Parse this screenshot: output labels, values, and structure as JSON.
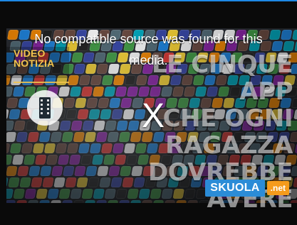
{
  "video_player": {
    "poster": {
      "banner": {
        "line1": "VIDEO",
        "line2": "NOTIZIA"
      },
      "headline": {
        "line1": "LE CINQUE APP",
        "line2": "CHE OGNI",
        "line3": "RAGAZZA",
        "line4": "DOVREBBE AVERE"
      },
      "logo": {
        "main": "SKUOLA",
        "suffix": ".net"
      },
      "icons": {
        "film_badge_icon": "film-icon"
      }
    },
    "error": {
      "message_line1": "No compatible source was found for this",
      "message_line2": "media.",
      "close_label": "X"
    },
    "colors": {
      "frame_top_border": "#1e88e5",
      "banner_text": "#f2c44d",
      "logo_main_bg": "#2b8cd7",
      "logo_suffix_bg": "#f59b1c"
    }
  }
}
